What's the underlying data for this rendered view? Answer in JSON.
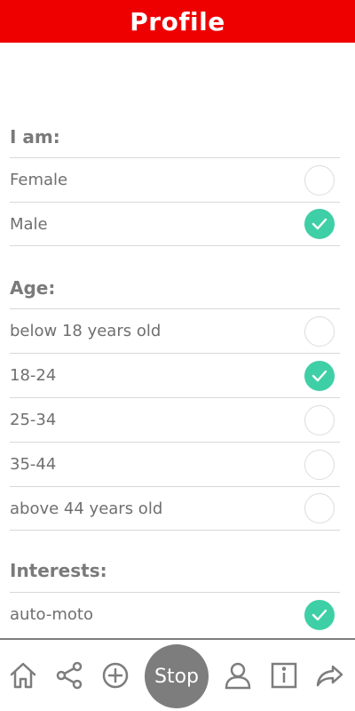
{
  "header": {
    "title": "Profile"
  },
  "sections": {
    "gender": {
      "title": "I am:",
      "options": [
        {
          "label": "Female",
          "checked": false
        },
        {
          "label": "Male",
          "checked": true
        }
      ]
    },
    "age": {
      "title": "Age:",
      "options": [
        {
          "label": "below 18 years old",
          "checked": false
        },
        {
          "label": "18-24",
          "checked": true
        },
        {
          "label": "25-34",
          "checked": false
        },
        {
          "label": "35-44",
          "checked": false
        },
        {
          "label": "above 44 years old",
          "checked": false
        }
      ]
    },
    "interests": {
      "title": "Interests:",
      "options": [
        {
          "label": "auto-moto",
          "checked": true
        }
      ]
    }
  },
  "nav": {
    "stop_label": "Stop",
    "icons": [
      "home-icon",
      "share-icon",
      "add-icon",
      "stop-button",
      "profile-icon",
      "info-icon",
      "forward-icon"
    ]
  },
  "colors": {
    "header": "#ee0000",
    "check_on": "#3fcfa6",
    "nav_gray": "#7d7d7d"
  }
}
